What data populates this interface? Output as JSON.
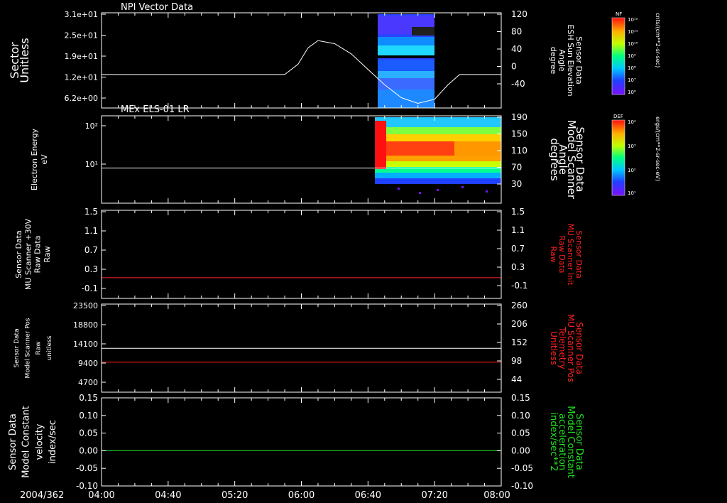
{
  "colors": {
    "background": "#000000",
    "axis": "#ffffff",
    "red_trace": "#ff2020",
    "green_trace": "#20e020",
    "white_trace": "#ffffff"
  },
  "time_axis": {
    "date_label": "2004/362",
    "ticks": [
      "04:00",
      "04:40",
      "05:20",
      "06:00",
      "06:40",
      "07:20",
      "08:00"
    ]
  },
  "colorbars": [
    {
      "tag": "NF",
      "unit": "cnts/(cm**2-sr-sec)",
      "tick_labels": [
        "10¹²",
        "10¹¹",
        "10¹⁰",
        "10⁹",
        "10⁸",
        "10⁷",
        "10⁶"
      ]
    },
    {
      "tag": "DEF",
      "unit": "ergs/(cm**2-sr-sec-eV)",
      "tick_labels": [
        "10⁴",
        "10³",
        "10²",
        "10¹"
      ]
    }
  ],
  "chart_data": [
    {
      "type": "heatmap",
      "title": "NPI Vector Data",
      "ylabel_lines": [
        "Sector",
        "Unitless"
      ],
      "ytick_labels": [
        "3.1e+01",
        "2.5e+01",
        "1.9e+01",
        "1.2e+01",
        "6.2e+00"
      ],
      "ylim": [
        0,
        31
      ],
      "right_ylabel_lines": [
        "Sensor Data",
        "ESH Sun Elevation",
        "Angle",
        "degree"
      ],
      "right_ytick_labels": [
        "120",
        "80",
        "40",
        "0",
        "-40"
      ],
      "right_ylim": [
        -60,
        120
      ],
      "data_time_range": [
        "06:45",
        "07:08"
      ],
      "overlay_series": {
        "name": "Sensor Data ESH Sun Elevation Angle",
        "axis": "right",
        "x": [
          "04:00",
          "05:50",
          "05:58",
          "06:04",
          "06:10",
          "06:20",
          "06:30",
          "06:40",
          "06:50",
          "07:00",
          "07:10",
          "07:20",
          "07:28",
          "07:35",
          "08:00"
        ],
        "y": [
          0,
          0,
          20,
          52,
          66,
          60,
          40,
          10,
          -20,
          -45,
          -56,
          -48,
          -20,
          0,
          0
        ]
      }
    },
    {
      "type": "heatmap",
      "title": "MEx ELS-01 LR",
      "ylabel_lines": [
        "Electron Energy",
        "eV"
      ],
      "ytick_labels": [
        "10²",
        "10¹"
      ],
      "yscale": "log",
      "right_ylabel_lines": [
        "Sensor Data",
        "Model Scanner",
        "Angle",
        "degrees"
      ],
      "right_ytick_labels": [
        "190",
        "150",
        "110",
        "70",
        "30"
      ],
      "right_ylim": [
        10,
        190
      ],
      "data_time_range": [
        "06:40",
        "08:00"
      ],
      "overlay_series": {
        "name": "Sensor Data Model Scanner Angle",
        "axis": "right",
        "x": [
          "04:00",
          "08:00"
        ],
        "y": [
          82,
          82
        ]
      }
    },
    {
      "type": "line",
      "ylabel_lines": [
        "Sensor Data",
        "MU Scanner +30V",
        "Raw Data",
        "Raw"
      ],
      "ytick_labels": [
        "1.5",
        "1.1",
        "0.7",
        "0.3",
        "-0.1"
      ],
      "ylim": [
        -0.5,
        1.5
      ],
      "right_ylabel_lines": [
        "Sensor Data",
        "MU Scanner Init",
        "Raw Data",
        "Raw"
      ],
      "right_ytick_labels": [
        "1.5",
        "1.1",
        "0.7",
        "0.3",
        "-0.1"
      ],
      "series": [
        {
          "color": "#ff2020",
          "x": [
            "04:00",
            "08:00"
          ],
          "y": [
            -0.03,
            -0.03
          ]
        }
      ]
    },
    {
      "type": "line",
      "ylabel_lines": [
        "Sensor Data",
        "Model Scanner Pos",
        "Raw",
        "unitless"
      ],
      "ytick_labels": [
        "23500",
        "18800",
        "14100",
        "9400",
        "4700"
      ],
      "ylim": [
        0,
        23500
      ],
      "right_ylabel_lines": [
        "Sensor Data",
        "MU Scanner Pos",
        "Telemetry",
        "Unitless"
      ],
      "right_ytick_labels": [
        "260",
        "206",
        "152",
        "98",
        "44"
      ],
      "right_ylim": [
        -10,
        260
      ],
      "series": [
        {
          "color": "#ffffff",
          "axis": "left",
          "x": [
            "04:00",
            "08:00"
          ],
          "y": [
            11700,
            11700
          ]
        },
        {
          "color": "#ff2020",
          "axis": "right",
          "x": [
            "04:00",
            "08:00"
          ],
          "y": [
            82,
            82
          ]
        }
      ]
    },
    {
      "type": "line",
      "ylabel_lines": [
        "Sensor Data",
        "Model Constant",
        "velocity",
        "index/sec"
      ],
      "ytick_labels": [
        "0.15",
        "0.10",
        "0.05",
        "0.00",
        "-0.05",
        "-0.10"
      ],
      "ylim": [
        -0.1,
        0.15
      ],
      "right_ylabel_lines": [
        "Sensor Data",
        "Model Constant",
        "acceleration",
        "index/sec**2"
      ],
      "right_ytick_labels": [
        "0.15",
        "0.10",
        "0.05",
        "0.00",
        "-0.05",
        "-0.10"
      ],
      "series": [
        {
          "color": "#20e020",
          "x": [
            "04:00",
            "08:00"
          ],
          "y": [
            0,
            0
          ]
        }
      ]
    }
  ]
}
